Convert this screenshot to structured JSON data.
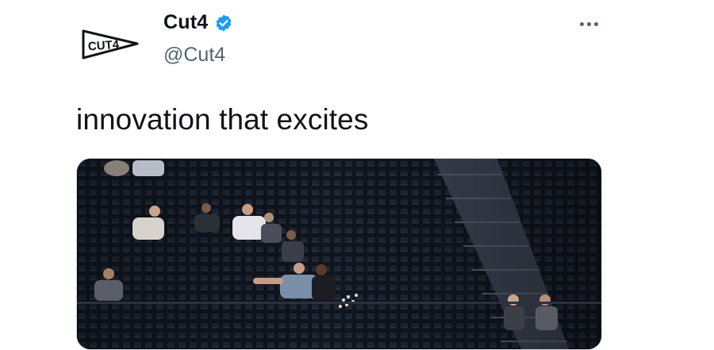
{
  "tweet": {
    "author": {
      "display_name": "Cut4",
      "handle": "@Cut4",
      "verified": true,
      "avatar_icon": "pennant-logo-icon",
      "avatar_logo_text": "CUT4"
    },
    "more_icon": "more-dots-icon",
    "text": "innovation that excites",
    "media": {
      "type": "video-thumbnail",
      "description_icon": "stadium-stands-image"
    }
  },
  "colors": {
    "text_primary": "#0f1419",
    "text_secondary": "#536471",
    "verified_blue": "#1d9bf0",
    "media_border": "#cfd9de"
  }
}
